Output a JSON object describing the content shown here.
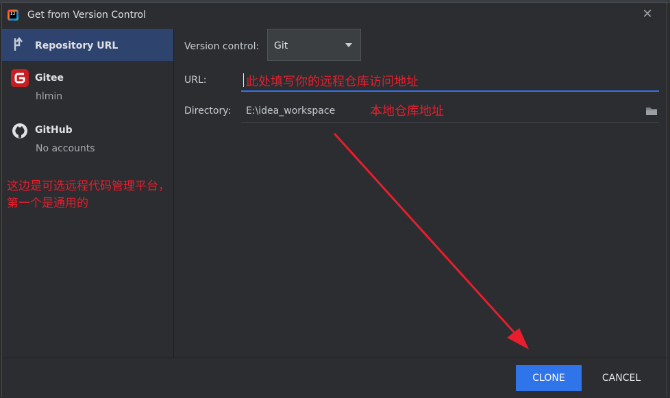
{
  "window": {
    "title": "Get from Version Control"
  },
  "sidebar": {
    "items": [
      {
        "label": "Repository URL",
        "sub": ""
      },
      {
        "label": "Gitee",
        "sub": "hlmin"
      },
      {
        "label": "GitHub",
        "sub": "No accounts"
      }
    ]
  },
  "form": {
    "version_control_label": "Version control:",
    "version_control_value": "Git",
    "url_label": "URL:",
    "url_value": "此处填写你的远程仓库访问地址",
    "directory_label": "Directory:",
    "directory_value": "E:\\idea_workspace",
    "directory_note": "本地仓库地址"
  },
  "annotation": {
    "side_note_line1": "这边是可选远程代码管理平台，",
    "side_note_line2": "第一个是通用的"
  },
  "buttons": {
    "clone": "CLONE",
    "cancel": "CANCEL"
  },
  "colors": {
    "accent": "#2f74e8",
    "annotation": "#e81e2e",
    "gitee": "#c71d23",
    "selection": "#2e436e"
  }
}
